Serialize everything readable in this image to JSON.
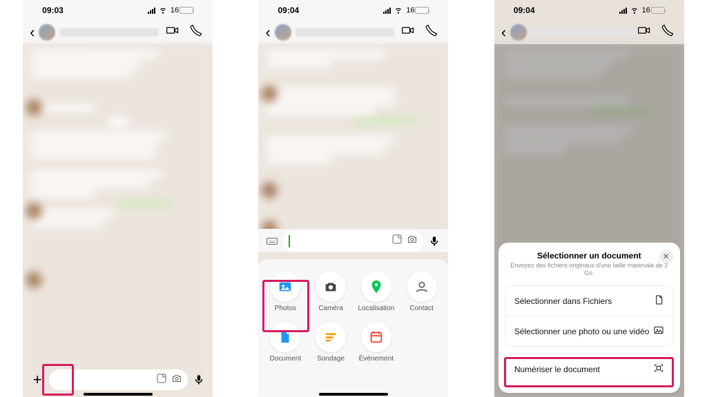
{
  "status": {
    "time1": "09:03",
    "time2": "09:04",
    "time3": "09:04",
    "battery_pct": "16"
  },
  "attachments": {
    "photos": "Photos",
    "camera": "Caméra",
    "location": "Localisation",
    "contact": "Contact",
    "document": "Document",
    "poll": "Sondage",
    "event": "Événement"
  },
  "docSheet": {
    "title": "Sélectionner un document",
    "subtitle": "Envoyez des fichiers originaux d'une taille maximale de 2 Go.",
    "pickFiles": "Sélectionner dans Fichiers",
    "pickPhoto": "Sélectionner une photo ou une vidéo",
    "scan": "Numériser le document"
  }
}
